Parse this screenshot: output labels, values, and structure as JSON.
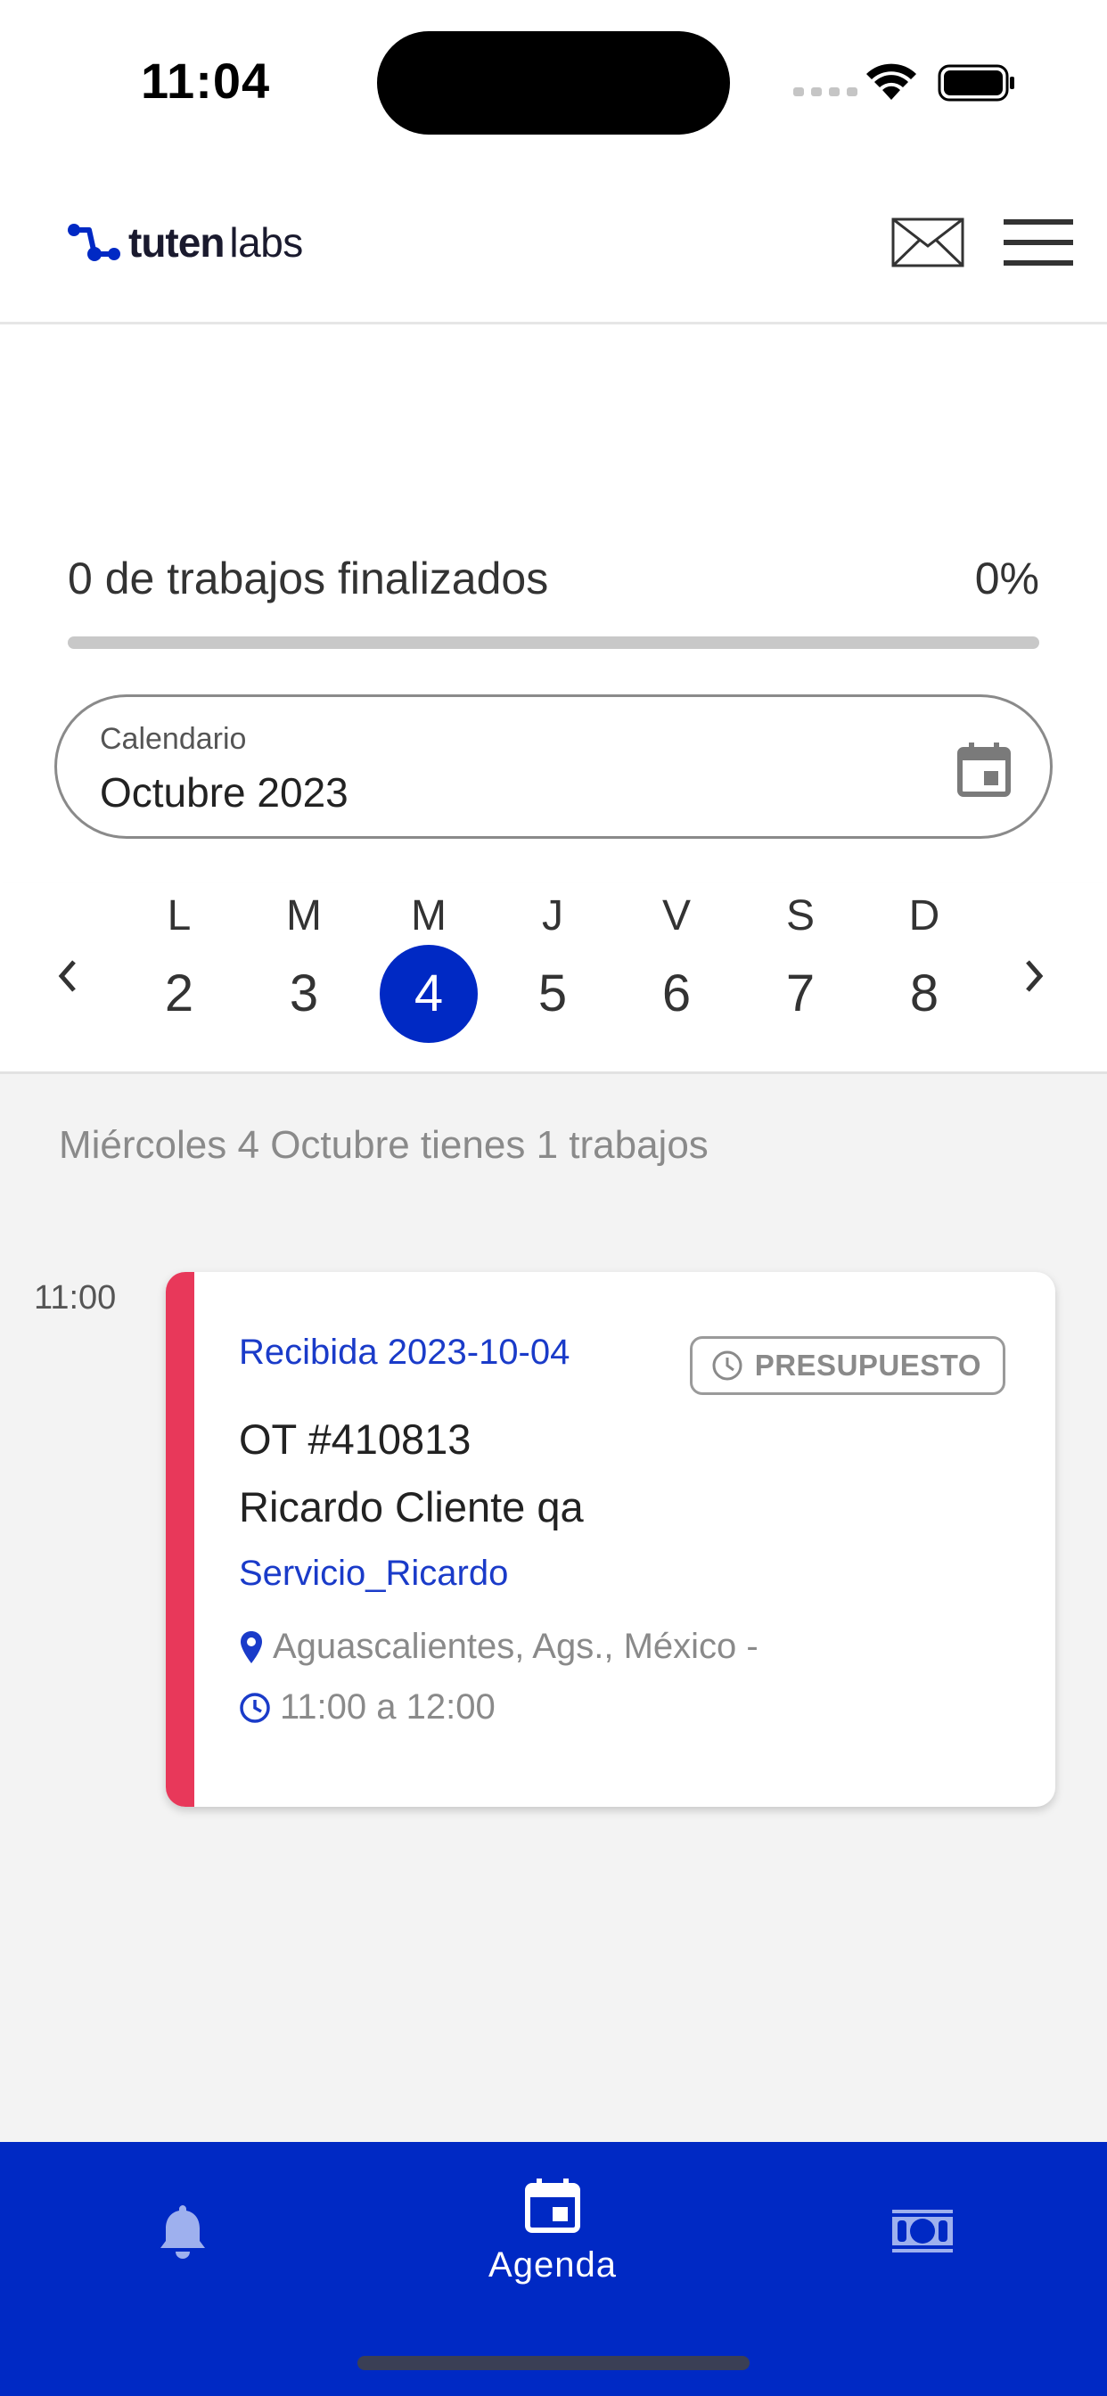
{
  "status_bar": {
    "time": "11:04"
  },
  "header": {
    "logo_bold": "tuten",
    "logo_light": "labs",
    "mail_icon": "mail-icon",
    "menu_icon": "hamburger-menu-icon"
  },
  "progress": {
    "label": "0 de trabajos finalizados",
    "percent_text": "0%",
    "value": 0
  },
  "calendar_field": {
    "label": "Calendario",
    "value": "Octubre 2023",
    "icon": "calendar-icon"
  },
  "week": {
    "days": [
      {
        "letter": "L",
        "number": "2",
        "selected": false
      },
      {
        "letter": "M",
        "number": "3",
        "selected": false
      },
      {
        "letter": "M",
        "number": "4",
        "selected": true
      },
      {
        "letter": "J",
        "number": "5",
        "selected": false
      },
      {
        "letter": "V",
        "number": "6",
        "selected": false
      },
      {
        "letter": "S",
        "number": "7",
        "selected": false
      },
      {
        "letter": "D",
        "number": "8",
        "selected": false
      }
    ]
  },
  "agenda": {
    "summary": "Miércoles 4 Octubre tienes 1 trabajos",
    "slot_time": "11:00",
    "job": {
      "received": "Recibida 2023-10-04",
      "badge": "PRESUPUESTO",
      "ot": "OT #410813",
      "client": "Ricardo Cliente qa",
      "service": "Servicio_Ricardo",
      "location": "Aguascalientes, Ags., México -",
      "hours": "11:00 a 12:00"
    }
  },
  "bottom_nav": {
    "agenda_label": "Agenda",
    "active": "agenda"
  },
  "colors": {
    "primary": "#0029c4",
    "accent_stripe": "#e8385a",
    "link_blue": "#1a3bc9"
  }
}
